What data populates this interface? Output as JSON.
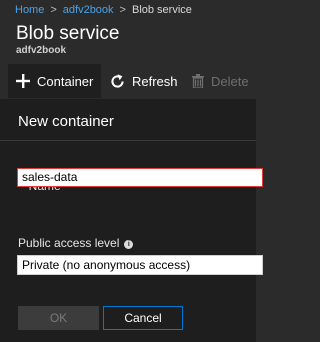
{
  "breadcrumb": {
    "items": [
      "Home",
      "adfv2book"
    ],
    "separator": ">",
    "current": "Blob service"
  },
  "header": {
    "title": "Blob service",
    "subtitle": "adfv2book"
  },
  "toolbar": {
    "container_label": "Container",
    "container_icon": "plus-icon",
    "refresh_label": "Refresh",
    "refresh_icon": "refresh-icon",
    "delete_label": "Delete",
    "delete_icon": "trash-icon"
  },
  "panel": {
    "title": "New container",
    "name_field": {
      "required_mark": "*",
      "label": "Name",
      "value": "sales-data"
    },
    "access_field": {
      "label": "Public access level",
      "info_icon": "info-icon",
      "info_glyph": "i",
      "selected": "Private (no anonymous access)"
    },
    "ok_label": "OK",
    "cancel_label": "Cancel"
  },
  "colors": {
    "accent": "#0078d4",
    "link": "#4aa3e8",
    "error": "#e81123",
    "background": "#2b2b2b",
    "panel": "#1e1e1e"
  }
}
